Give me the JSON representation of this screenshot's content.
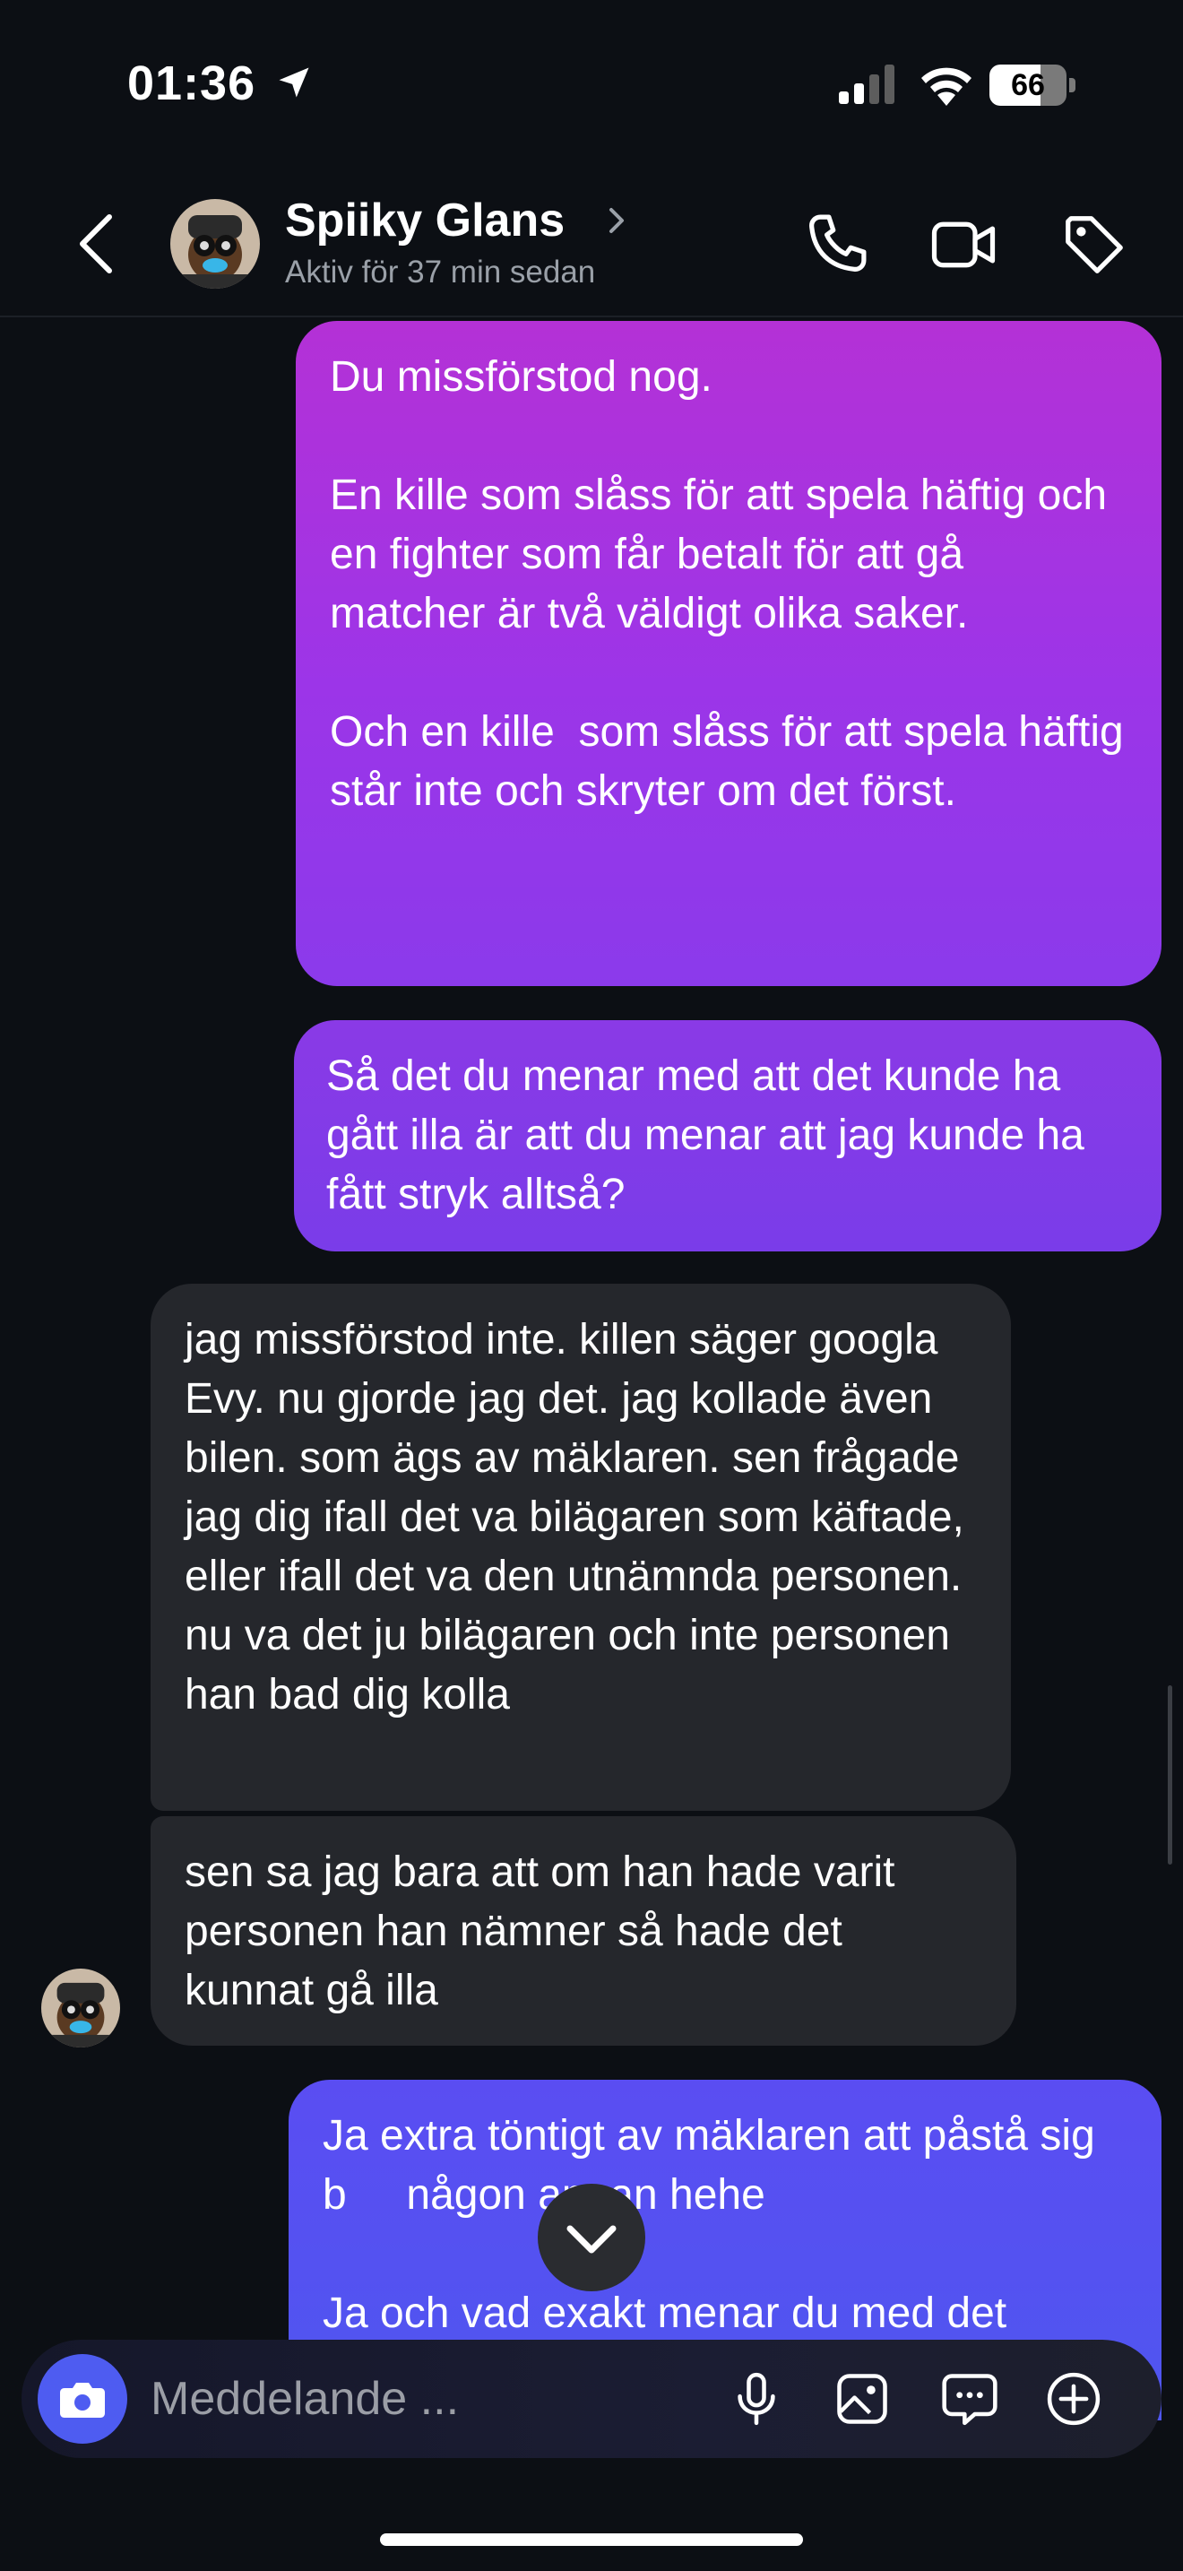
{
  "status_bar": {
    "time": "01:36",
    "battery": "66",
    "battery_level": 0.66
  },
  "header": {
    "name": "Spiiky Glans",
    "subtitle": "Aktiv för 37 min sedan"
  },
  "messages": [
    {
      "direction": "sent",
      "text": "Du missförstod nog.\n\nEn kille som slåss för att spela häftig och en fighter som får betalt för att gå matcher är två väldigt olika saker.\n\nOch en kille  som slåss för att spela häftig står inte och skryter om det först."
    },
    {
      "direction": "sent",
      "text": "Så det du menar med att det kunde ha gått illa är att du menar att jag kunde ha fått stryk alltså?"
    },
    {
      "direction": "received",
      "text": "jag missförstod inte. killen säger googla Evy. nu gjorde jag det. jag kollade även bilen. som ägs av mäklaren. sen frågade jag dig ifall det va bilägaren som käftade, eller ifall det va den utnämnda personen. nu va det ju bilägaren och inte personen han bad dig kolla"
    },
    {
      "direction": "received",
      "text": "sen sa jag bara att om han hade varit personen han nämner så hade det kunnat gå illa"
    },
    {
      "direction": "sent",
      "text": "Ja extra töntigt av mäklaren att påstå sig b     någon annan hehe\n\nJa och vad exakt menar du med det"
    }
  ],
  "composer": {
    "placeholder": "Meddelande ..."
  },
  "icons": {
    "back": "chevron-left-icon",
    "call": "phone-icon",
    "video": "video-camera-icon",
    "tag": "tag-icon",
    "camera": "camera-icon",
    "mic": "microphone-icon",
    "gallery": "image-icon",
    "sticker": "chat-bubble-icon",
    "more": "plus-circle-icon",
    "scroll": "chevron-down-icon"
  },
  "colors": {
    "background": "#0c0f14",
    "sent_top": "#b431d6",
    "sent_mid": "#8a3ae6",
    "sent_bottom": "#5a4df2",
    "received": "#25272c",
    "accent": "#4e5cf1"
  }
}
